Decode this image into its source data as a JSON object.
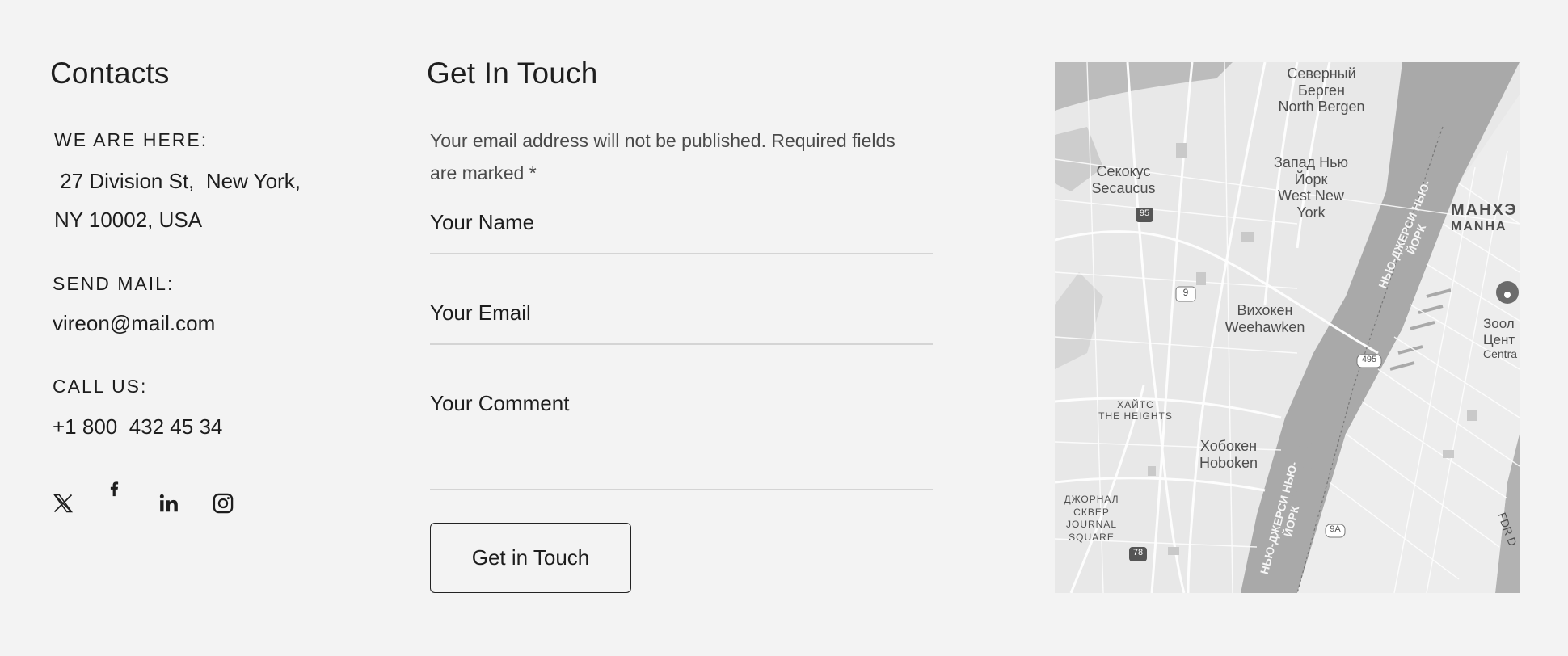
{
  "contacts": {
    "title": "Contacts",
    "address_label": "WE ARE HERE:",
    "address_line1": " 27 Division St,  New York,",
    "address_line2": "NY 10002, USA",
    "mail_label": "SEND MAIL:",
    "mail_value": "vireon@mail.com",
    "call_label": "CALL US:",
    "call_value": "+1 800  432 45 34",
    "social": [
      "x-icon",
      "facebook-icon",
      "linkedin-icon",
      "instagram-icon"
    ]
  },
  "form": {
    "title": "Get In Touch",
    "note": "Your email address will not be published. Required fields are marked *",
    "name_placeholder": "Your Name",
    "email_placeholder": "Your Email",
    "comment_placeholder": "Your Comment",
    "submit_label": "Get in Touch"
  },
  "map": {
    "labels": {
      "north_bergen_ru": "Северный Берген",
      "north_bergen": "North Bergen",
      "secaucus_ru": "Секокус",
      "secaucus": "Secaucus",
      "west_ny_ru": "Запад Нью Йорк",
      "west_ny": "West New York",
      "weehawken_ru": "Вихокен",
      "weehawken": "Weehawken",
      "manhattan_ru": "МАНХЭ",
      "manhattan": "MANHA",
      "zoo_ru": "Зоол Цент",
      "zoo": "Centra",
      "heights_ru": "ХАЙТС",
      "heights": "THE HEIGHTS",
      "hoboken_ru": "Хобокен",
      "hoboken": "Hoboken",
      "journal_ru": "ДЖОРНАЛ СКВЕР",
      "journal": "JOURNAL SQUARE",
      "river_ru1": "НЬЮ-ДЖЕРСИ НЬЮ-ЙОРК",
      "river_ru2": "НЬЮ-ДЖЕРСИ НЬЮ-ЙОРК",
      "fdr": "FDR D",
      "route_95": "95",
      "route_9": "9",
      "route_495": "495",
      "route_9a": "9A",
      "route_78": "78"
    }
  }
}
